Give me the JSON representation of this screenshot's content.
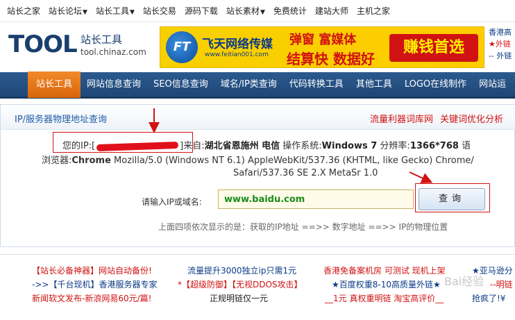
{
  "topnav": [
    {
      "label": "站长之家",
      "dropdown": false
    },
    {
      "label": "站长论坛",
      "dropdown": true
    },
    {
      "label": "站长工具",
      "dropdown": true
    },
    {
      "label": "站长交易",
      "dropdown": false
    },
    {
      "label": "源码下载",
      "dropdown": false
    },
    {
      "label": "站长素材",
      "dropdown": true
    },
    {
      "label": "免费统计",
      "dropdown": false
    },
    {
      "label": "建站大师",
      "dropdown": false
    },
    {
      "label": "主机之家",
      "dropdown": false
    }
  ],
  "logo": {
    "big": "TOOL",
    "cn": "站长工具",
    "url": "tool.chinaz.com"
  },
  "banner": {
    "badge": "FT",
    "title": "飞天网络传媒",
    "url": "www.feitian001.com",
    "line1": "弹窗 富媒体",
    "line2": "结算快 数据好",
    "cta": "赚钱首选"
  },
  "hk_box": {
    "l1": "香港高",
    "l2": "★外链",
    "l3": "-- 外链"
  },
  "mainnav": [
    "站长工具",
    "网站信息查询",
    "SEO信息查询",
    "域名/IP类查询",
    "代码转换工具",
    "其他工具",
    "LOGO在线制作",
    "网站运"
  ],
  "panel": {
    "title": "IP/服务器物理地址查询",
    "links": [
      "流量利器词库网",
      "关键词优化分析"
    ]
  },
  "result": {
    "ip_label": "您的IP:[",
    "ip_close": "]",
    "from_label": "来自:",
    "location": "湖北省恩施州 电信",
    "os_label": "操作系统:",
    "os_value": "Windows 7",
    "res_label": "分辨率:",
    "res_value": "1366*768",
    "lang_tail": "语",
    "browser_label": "浏览器:",
    "browser_value": "Chrome",
    "ua1": "Mozilla/5.0 (Windows NT 6.1) AppleWebKit/537.36 (KHTML, like Gecko) Chrome/",
    "ua2": "Safari/537.36 SE 2.X MetaSr 1.0"
  },
  "form": {
    "label": "请输入IP或域名:",
    "value": "www.baidu.com",
    "button": "查询",
    "hint": "上面四项依次显示的是：获取的IP地址 ==>> 数字地址 ==>> IP的物理位置"
  },
  "ads": {
    "r1c1": "【站长必备神器】网站自动备份!",
    "r1c2": "流量提升3000独立ip只需1元",
    "r1c3": "香港免备案机房 可测试 现机上架",
    "r1c4": "★亚马逊分",
    "r2c1": "->>【千台现机】香港服务器专家",
    "r2c2": "*【超级防御】【无视DDOS攻击】",
    "r2c3": "★百度权重8-10高质量外链★",
    "r2c4": "--明链",
    "r3c1": "新闻软文发布-新浪网易60元/篇!",
    "r3c2": "正规明链仅一元",
    "r3c3": "__1元 真权重明链 淘宝高评价__",
    "r3c4": "抢疯了!¥"
  },
  "watermark": "Bai经验"
}
